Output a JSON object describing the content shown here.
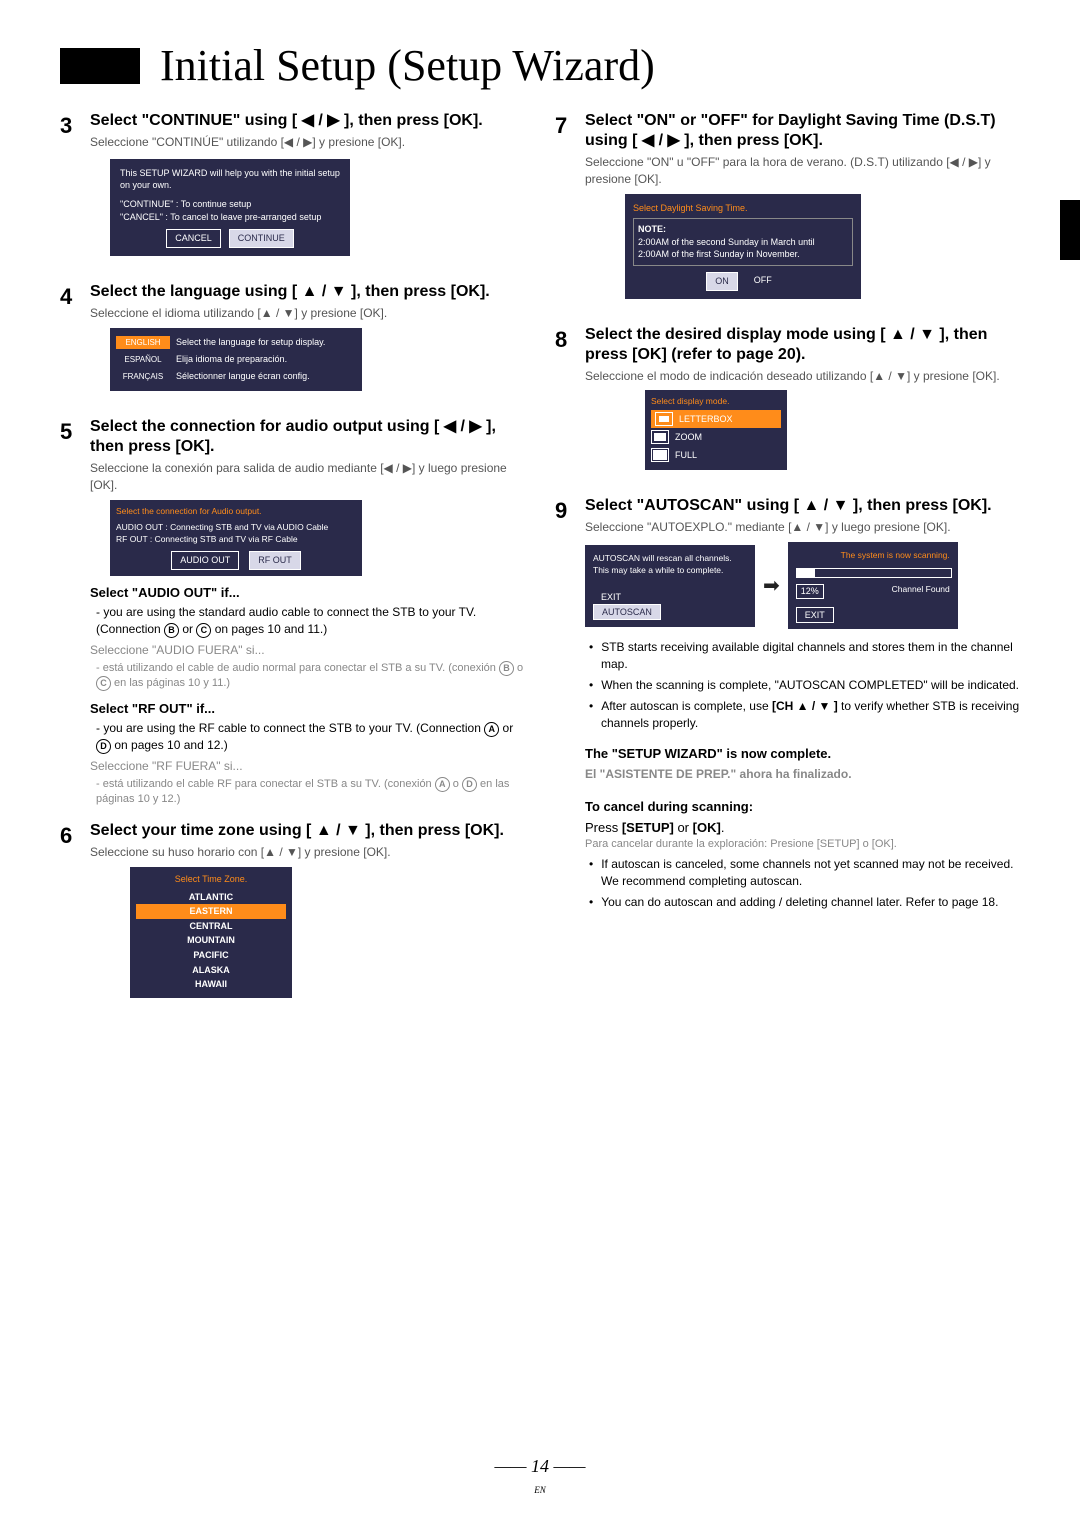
{
  "title": "Initial Setup (Setup Wizard)",
  "page_number": "14",
  "page_lang": "EN",
  "steps": {
    "s3": {
      "num": "3",
      "head": "Select \"CONTINUE\" using [ ◀ / ▶ ], then press [OK].",
      "sp": "Seleccione \"CONTINÚE\" utilizando [◀ / ▶] y presione [OK].",
      "osd_line1": "This SETUP WIZARD will help you with the initial setup on your own.",
      "osd_line2": "\"CONTINUE\" : To continue setup",
      "osd_line3": "\"CANCEL\"   : To cancel to leave pre-arranged setup",
      "btn_cancel": "CANCEL",
      "btn_continue": "CONTINUE"
    },
    "s4": {
      "num": "4",
      "head": "Select the language using [ ▲ / ▼ ], then press [OK].",
      "sp": "Seleccione el idioma utilizando [▲ / ▼] y presione [OK].",
      "rows": [
        {
          "tag": "ENGLISH",
          "txt": "Select the language for setup display.",
          "hi": true
        },
        {
          "tag": "ESPAÑOL",
          "txt": "Elija idioma de preparación.",
          "hi": false
        },
        {
          "tag": "FRANÇAIS",
          "txt": "Sélectionner langue écran config.",
          "hi": false
        }
      ]
    },
    "s5": {
      "num": "5",
      "head": "Select the connection for audio output using [ ◀ / ▶ ], then press [OK].",
      "sp": "Seleccione la conexión para salida de audio mediante [◀ / ▶] y luego presione [OK].",
      "osd_title": "Select the connection for Audio output.",
      "osd_a": "AUDIO OUT : Connecting STB and TV via AUDIO Cable",
      "osd_r": "RF OUT       : Connecting STB and TV via RF Cable",
      "btn_audio": "AUDIO OUT",
      "btn_rf": "RF OUT",
      "sub_audio_h": "Select \"AUDIO OUT\" if...",
      "sub_audio_b": "- you are using the standard audio cable to connect the STB to your TV. (Connection B or C on pages 10 and 11.)",
      "sub_audio_sp_h": "Seleccione \"AUDIO FUERA\" si...",
      "sub_audio_sp_b": "- está utilizando el cable de audio normal para conectar el STB a su TV. (conexión B o C en las páginas 10 y 11.)",
      "sub_rf_h": "Select \"RF OUT\" if...",
      "sub_rf_b": "- you are using the RF cable to connect the STB to your TV. (Connection A or D on pages 10 and 12.)",
      "sub_rf_sp_h": "Seleccione \"RF FUERA\" si...",
      "sub_rf_sp_b": "- está utilizando el cable RF para conectar el STB a su TV. (conexión A o D en las páginas 10 y 12.)"
    },
    "s6": {
      "num": "6",
      "head": "Select your time zone using [ ▲ / ▼ ], then press [OK].",
      "sp": "Seleccione su huso horario con  [▲ / ▼] y presione [OK].",
      "tz_title": "Select Time Zone.",
      "tz": [
        "ATLANTIC",
        "EASTERN",
        "CENTRAL",
        "MOUNTAIN",
        "PACIFIC",
        "ALASKA",
        "HAWAII"
      ],
      "tz_hi": "EASTERN"
    },
    "s7": {
      "num": "7",
      "head": "Select \"ON\" or \"OFF\" for Daylight Saving Time (D.S.T) using [ ◀ / ▶ ], then press [OK].",
      "sp": "Seleccione \"ON\" u \"OFF\" para la hora de verano. (D.S.T) utilizando [◀ / ▶] y presione [OK].",
      "dst_title": "Select Daylight Saving Time.",
      "dst_note_h": "NOTE:",
      "dst_note": "2:00AM of the second Sunday in March until 2:00AM of the first Sunday in November.",
      "btn_on": "ON",
      "btn_off": "OFF"
    },
    "s8": {
      "num": "8",
      "head": "Select the desired display mode using [ ▲ / ▼ ], then press [OK] (refer to page 20).",
      "sp": "Seleccione el modo de indicación deseado utilizando [▲ / ▼] y presione [OK].",
      "disp_title": "Select display mode.",
      "modes": [
        "LETTERBOX",
        "ZOOM",
        "FULL"
      ]
    },
    "s9": {
      "num": "9",
      "head": "Select \"AUTOSCAN\" using [ ▲ / ▼ ], then press [OK].",
      "sp": "Seleccione \"AUTOEXPLO.\" mediante [▲ / ▼] y luego presione [OK].",
      "scan_left_l1": "AUTOSCAN will rescan all channels.",
      "scan_left_l2": "This may take a while to complete.",
      "btn_exit": "EXIT",
      "btn_auto": "AUTOSCAN",
      "scan_right_title": "The system is now scanning.",
      "scan_pct": "12%",
      "scan_found": "Channel Found",
      "bullets": [
        "STB starts receiving available digital channels and stores them in the channel map.",
        "When the scanning is complete, \"AUTOSCAN COMPLETED\" will be indicated.",
        "After autoscan is complete, use [CH ▲ / ▼ ] to verify whether STB is receiving channels properly."
      ],
      "final": "The \"SETUP WIZARD\" is now complete.",
      "final_sp": "El \"ASISTENTE DE PREP.\" ahora ha finalizado.",
      "cancel_h": "To cancel during scanning:",
      "cancel_b": "Press [SETUP] or [OK].",
      "cancel_sp": "Para cancelar durante la exploración: Presione [SETUP] o [OK].",
      "cancel_bullets": [
        "If autoscan is canceled, some channels not yet scanned may not be received. We recommend completing autoscan.",
        "You can do autoscan and adding / deleting channel later. Refer to page 18."
      ]
    }
  }
}
